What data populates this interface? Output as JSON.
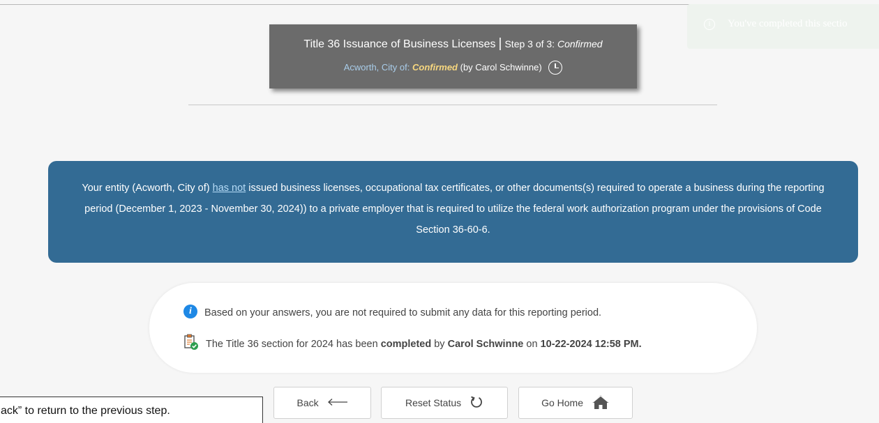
{
  "toast": {
    "text": "You've completed this sectio"
  },
  "header": {
    "title": "Title 36 Issuance of Business Licenses",
    "separator": "|",
    "step_prefix": "Step 3 of 3:",
    "step_status": "Confirmed",
    "entity_label": "Acworth, City of:",
    "status_label": "Confirmed",
    "status_by": "(by Carol Schwinne)"
  },
  "panel": {
    "text_before_link": "Your entity (Acworth, City of) ",
    "link_text": "has not",
    "text_after_link": " issued business licenses, occupational tax certificates, or other documents(s) required to operate a business during the reporting period (December 1, 2023 - November 30, 2024)) to a private employer that is required to utilize the federal work authorization program under the provisions of Code Section 36-60-6."
  },
  "info": {
    "line1": "Based on your answers, you are not required to submit any data for this reporting period.",
    "line2_a": "The Title 36 section for 2024 has been ",
    "line2_completed": "completed",
    "line2_b": " by ",
    "line2_user": "Carol Schwinne",
    "line2_c": " on ",
    "line2_datetime": "10-22-2024 12:58 PM."
  },
  "buttons": {
    "back": "Back",
    "reset": "Reset Status",
    "home": "Go Home"
  },
  "tooltip": {
    "text": "ack” to return to the previous step."
  },
  "colors": {
    "header_bg": "#6b6b6b",
    "panel_bg": "#336b94",
    "status_gold": "#f7d77f",
    "info_blue": "#1e88e5",
    "check_green": "#2e9e4f"
  }
}
